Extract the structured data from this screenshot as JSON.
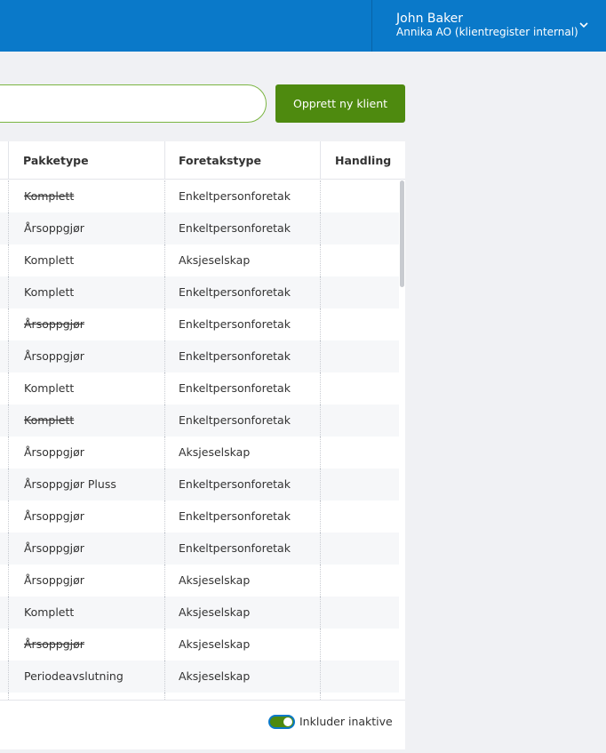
{
  "header": {
    "user_name": "John Baker",
    "organization": "Annika AO (klientregister internal)",
    "menu_icon": "chevron-down-icon",
    "color": "#0a79c9"
  },
  "toolbar": {
    "search_value": "",
    "create_button_label": "Opprett ny klient",
    "create_button_color": "#4e8a0f"
  },
  "table": {
    "columns": [
      "Pakketype",
      "Foretakstype",
      "Handling"
    ],
    "rows": [
      {
        "pakketype": "Komplett",
        "foretakstype": "Enkeltpersonforetak",
        "inactive": true
      },
      {
        "pakketype": "Årsoppgjør",
        "foretakstype": "Enkeltpersonforetak",
        "inactive": false
      },
      {
        "pakketype": "Komplett",
        "foretakstype": "Aksjeselskap",
        "inactive": false
      },
      {
        "pakketype": "Komplett",
        "foretakstype": "Enkeltpersonforetak",
        "inactive": false
      },
      {
        "pakketype": "Årsoppgjør",
        "foretakstype": "Enkeltpersonforetak",
        "inactive": true
      },
      {
        "pakketype": "Årsoppgjør",
        "foretakstype": "Enkeltpersonforetak",
        "inactive": false
      },
      {
        "pakketype": "Komplett",
        "foretakstype": "Enkeltpersonforetak",
        "inactive": false
      },
      {
        "pakketype": "Komplett",
        "foretakstype": "Enkeltpersonforetak",
        "inactive": true
      },
      {
        "pakketype": "Årsoppgjør",
        "foretakstype": "Aksjeselskap",
        "inactive": false
      },
      {
        "pakketype": "Årsoppgjør Pluss",
        "foretakstype": "Enkeltpersonforetak",
        "inactive": false
      },
      {
        "pakketype": "Årsoppgjør",
        "foretakstype": "Enkeltpersonforetak",
        "inactive": false
      },
      {
        "pakketype": "Årsoppgjør",
        "foretakstype": "Enkeltpersonforetak",
        "inactive": false
      },
      {
        "pakketype": "Årsoppgjør",
        "foretakstype": "Aksjeselskap",
        "inactive": false
      },
      {
        "pakketype": "Komplett",
        "foretakstype": "Aksjeselskap",
        "inactive": false
      },
      {
        "pakketype": "Årsoppgjør",
        "foretakstype": "Aksjeselskap",
        "inactive": true
      },
      {
        "pakketype": "Periodeavslutning",
        "foretakstype": "Aksjeselskap",
        "inactive": false
      },
      {
        "pakketype": "",
        "foretakstype": "",
        "inactive": false
      }
    ]
  },
  "footer": {
    "toggle_label": "Inkluder inaktive",
    "toggle_on": true
  }
}
